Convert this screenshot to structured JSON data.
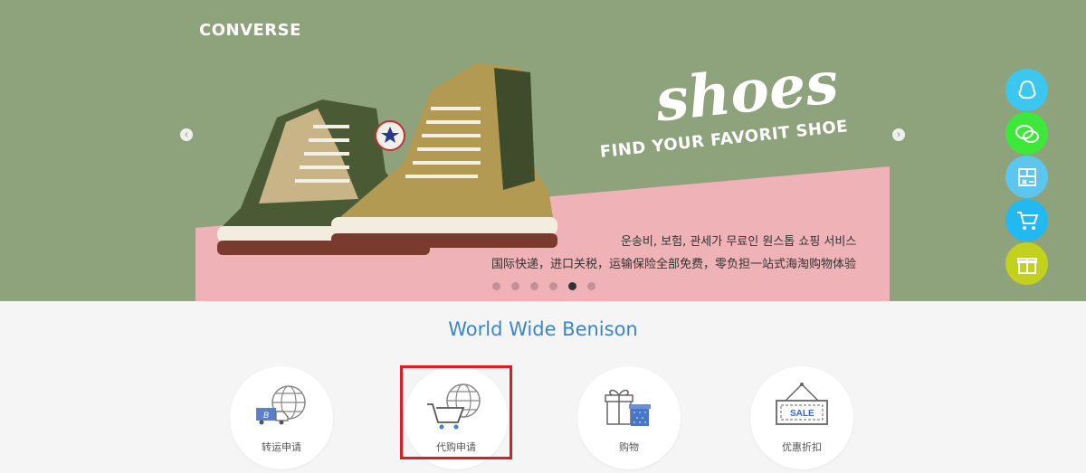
{
  "hero": {
    "brand": "CONVERSE",
    "title": "shoes",
    "tagline": "FIND YOUR FAVORIT SHOE",
    "korean_text": "운송비, 보험, 관세가 무료인 원스톱 쇼핑 서비스",
    "chinese_text": "国际快递，进口关税，运输保险全部免费，零负担一站式海淘购物体验",
    "prev_icon": "chevron-left-icon",
    "next_icon": "chevron-right-icon",
    "slide_count": 6,
    "active_slide": 5
  },
  "side_buttons": [
    {
      "icon": "qq-penguin-icon",
      "color": "#3cc8ee"
    },
    {
      "icon": "wechat-icon",
      "color": "#3ee83a"
    },
    {
      "icon": "calculator-icon",
      "color": "#5cc6ee"
    },
    {
      "icon": "shopping-cart-icon",
      "color": "#22b8f0"
    },
    {
      "icon": "gift-icon",
      "color": "#c2d01e"
    }
  ],
  "section": {
    "title": "World Wide Benison"
  },
  "services": [
    {
      "label": "转运申请",
      "icon": "shipping-truck-globe-icon"
    },
    {
      "label": "代购申请",
      "icon": "cart-globe-icon",
      "highlighted": true
    },
    {
      "label": "购物",
      "icon": "gift-box-icon"
    },
    {
      "label": "优惠折扣",
      "icon": "sale-sign-icon",
      "sign_text": "SALE"
    }
  ]
}
